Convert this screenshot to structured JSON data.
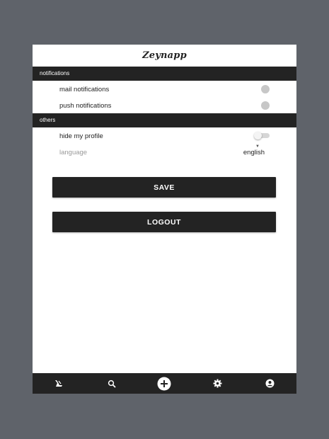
{
  "app": {
    "logo_text": "Zeynapp"
  },
  "sections": {
    "notifications": {
      "title": "notifications",
      "mail_label": "mail notifications",
      "push_label": "push notifications"
    },
    "others": {
      "title": "others",
      "hide_profile_label": "hide my profile",
      "language_label": "language",
      "language_value": "english"
    }
  },
  "buttons": {
    "save": "SAVE",
    "logout": "LOGOUT"
  },
  "bottom_nav": {
    "items": [
      "home-icon",
      "search-icon",
      "add-icon",
      "settings-icon",
      "profile-icon"
    ]
  },
  "colors": {
    "background": "#5f636a",
    "dark": "#232323",
    "toggle_off": "#c7c7c7"
  }
}
